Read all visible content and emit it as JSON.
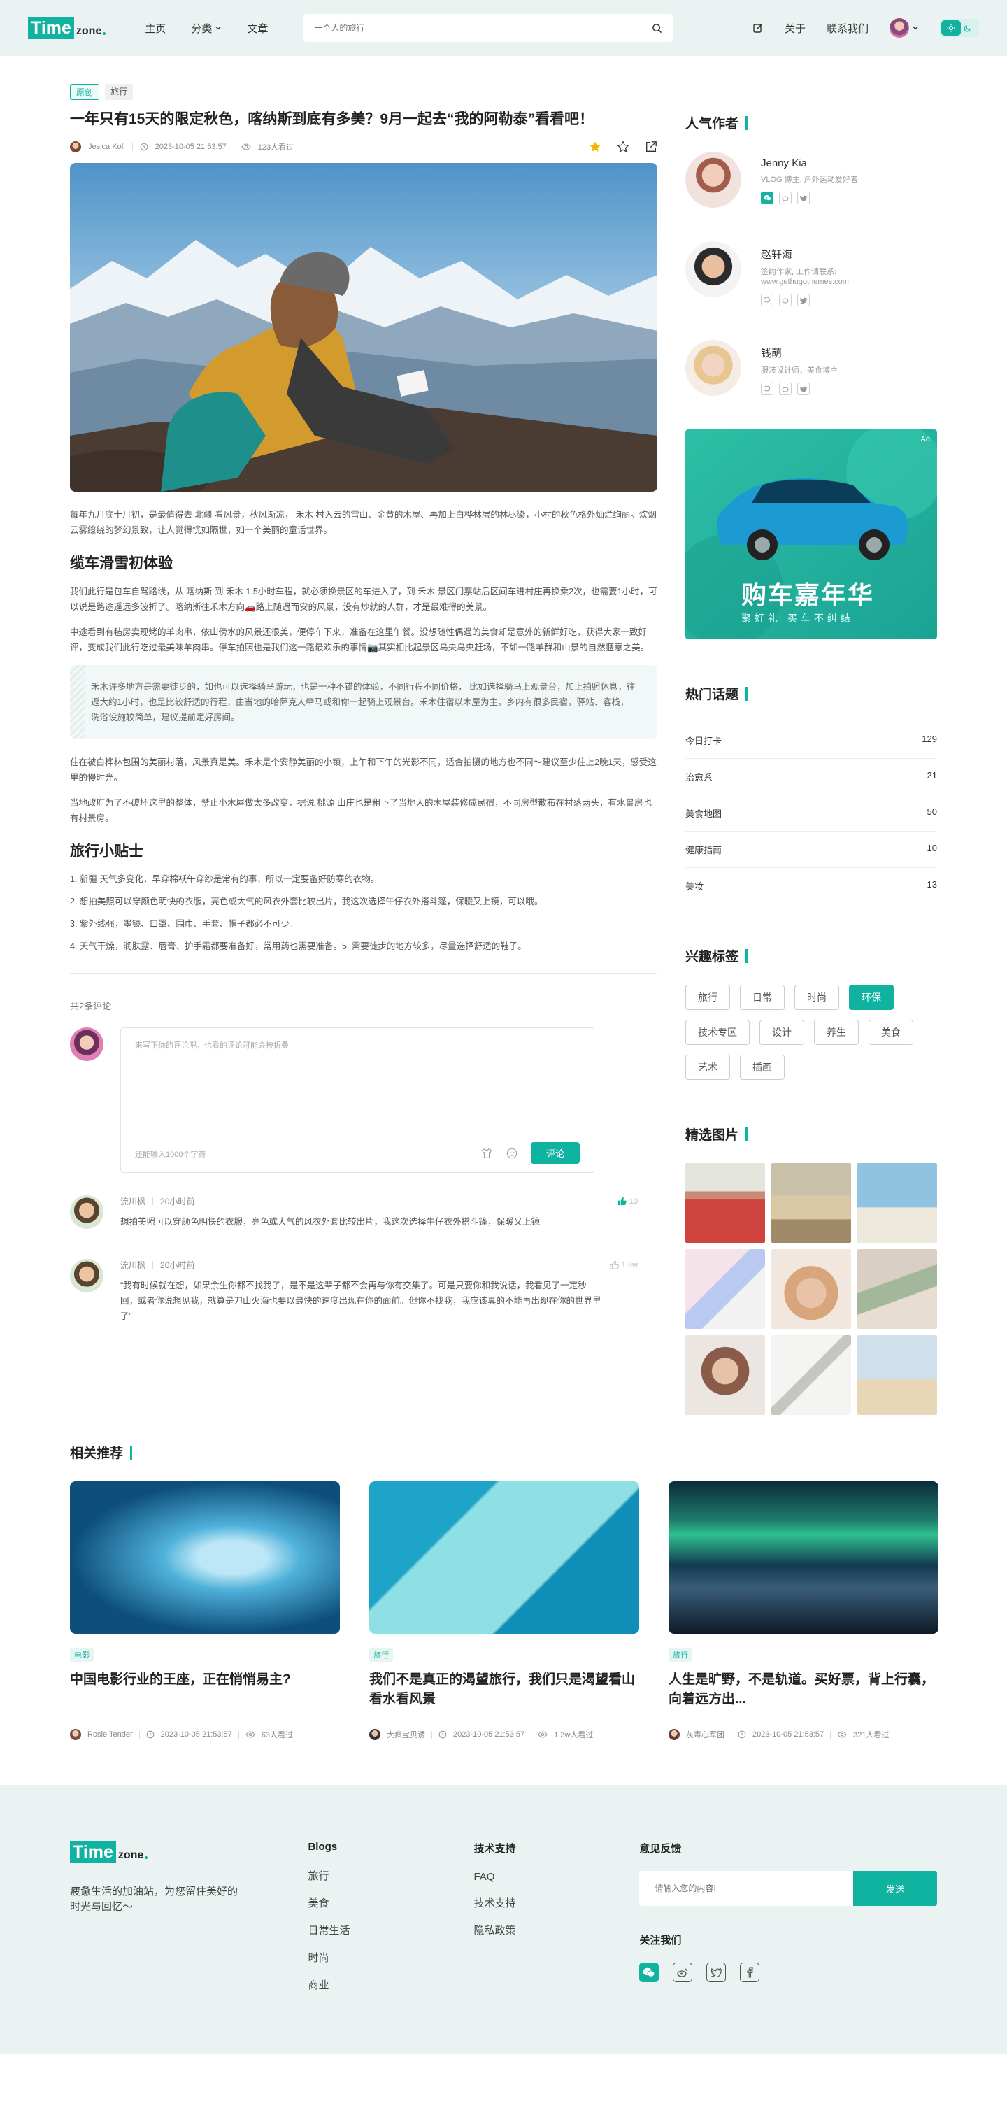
{
  "header": {
    "logo_box": "Time",
    "logo_rest": "zone",
    "nav": [
      "主页",
      "分类",
      "文章"
    ],
    "search_placeholder": "一个人的旅行",
    "links": [
      "关于",
      "联系我们"
    ]
  },
  "article": {
    "tags": [
      "原创",
      "旅行"
    ],
    "title": "一年只有15天的限定秋色，喀纳斯到底有多美？9月一起去“我的阿勒泰”看看吧！",
    "author": "Jesica Koli",
    "date": "2023-10-05 21:53:57",
    "views": "123人看过",
    "p1": "每年九月底十月初，是最值得去 北疆 看风景，秋风渐凉， 禾木 村入云的雪山、金黄的木屋、再加上白桦林层的林尽染，小村的秋色格外灿烂绚丽。炊烟云雾缭绕的梦幻景致，让人觉得恍如隔世，如一个美丽的童话世界。",
    "h2a": "缆车滑雪初体验",
    "p2": "我们此行是包车自驾路线，从 喀纳斯 到 禾木 1.5小时车程，就必须换景区的车进入了，到 禾木 景区门票站后区间车进村庄再换乘2次，也需要1小时，可以说是路途遥远多波折了。喀纳斯往禾木方向🚗路上随遇而安的风景，没有炒就的人群，才是最难得的美景。",
    "p3": "中途看到有毡房卖现烤的羊肉串，依山傍水的风景还很美，便停车下来，准备在这里午餐。没想随性偶遇的美食却是意外的新鲜好吃，获得大家一致好评，变成我们此行吃过最美味羊肉串。停车拍照也是我们这一路最欢乐的事情📷其实相比起景区乌央乌央赶场，不如一路羊群和山景的自然惬意之美。",
    "quote": "禾木许多地方是需要徒步的，如也可以选择骑马游玩，也是一种不错的体验，不同行程不同价格， 比如选择骑马上观景台，加上拍照休息，往返大约1小时，也是比较舒适的行程，由当地的哈萨克人牵马或和你一起骑上观景台。禾木住宿以木屋为主，乡内有很多民宿，驿站、客栈，洗浴设施较简单，建议提前定好房间。",
    "p4": "住在被白桦林包围的美丽村落，风景真是美。禾木是个安静美丽的小镇，上午和下午的光影不同，适合拍摄的地方也不同～建议至少住上2晚1天，感受这里的慢时光。",
    "p5": "当地政府为了不破坏这里的整体，禁止小木屋做太多改变，据说 桃源 山庄也是租下了当地人的木屋装修成民宿，不同房型散布在村落两头，有水景房也有村景房。",
    "h2b": "旅行小贴士",
    "tips": [
      "1. 新疆 天气多变化，早穿棉袄午穿纱是常有的事，所以一定要备好防寒的衣物。",
      "2. 想拍美照可以穿颜色明快的衣服，亮色或大气的风衣外套比较出片，我这次选择牛仔衣外搭斗篷，保暖又上镜，可以哦。",
      "3. 紫外线强，墨镜、口罩、围巾、手套、帽子都必不可少。",
      "4. 天气干燥，润肤露、唇膏、护手霜都要准备好，常用药也需要准备。5. 需要徒步的地方较多，尽量选择舒适的鞋子。"
    ]
  },
  "comments_section": {
    "count": "共2条评论",
    "placeholder": "来写下你的评论吧，也看的评论可能会被折叠",
    "limit": "还能输入1000个字符",
    "submit": "评论",
    "items": [
      {
        "name": "流川枫",
        "time": "20小时前",
        "likes": "10",
        "text": "想拍美照可以穿颜色明快的衣服，亮色或大气的风衣外套比较出片，我这次选择牛仔衣外搭斗篷，保暖又上镜"
      },
      {
        "name": "流川枫",
        "time": "20小时前",
        "likes": "1.3w",
        "text": "“我有时候就在想，如果余生你都不找我了，是不是这辈子都不会再与你有交集了。可是只要你和我说话，我看见了一定秒回，或者你说想见我，就算是刀山火海也要以最快的速度出现在你的面前。但你不找我，我应该真的不能再出现在你的世界里了”"
      }
    ]
  },
  "sidebar": {
    "authors_title": "人气作者",
    "authors": [
      {
        "name": "Jenny Kia",
        "desc": "VLOG 博主, 户外运动爱好者",
        "desc2": ""
      },
      {
        "name": "赵轩海",
        "desc": "签约作家, 工作请联系:",
        "desc2": "www.gethugothemes.com"
      },
      {
        "name": "钱萌",
        "desc": "服装设计师，美食博主",
        "desc2": ""
      }
    ],
    "ad_label": "Ad",
    "ad_title": "购车嘉年华",
    "ad_sub": "聚好礼 买车不纠结",
    "topics_title": "热门话题",
    "topics": [
      {
        "name": "今日打卡",
        "count": "129"
      },
      {
        "name": "治愈系",
        "count": "21"
      },
      {
        "name": "美食地图",
        "count": "50"
      },
      {
        "name": "健康指南",
        "count": "10"
      },
      {
        "name": "美妆",
        "count": "13"
      }
    ],
    "tags_title": "兴趣标签",
    "tags": [
      "旅行",
      "日常",
      "时尚",
      "环保",
      "技术专区",
      "设计",
      "养生",
      "美食",
      "艺术",
      "插画"
    ],
    "active_tag": "环保",
    "gallery_title": "精选图片"
  },
  "related": {
    "title": "相关推荐",
    "cards": [
      {
        "tag": "电影",
        "title": "中国电影行业的王座，正在悄悄易主?",
        "author": "Rosie Tender",
        "date": "2023-10-05 21:53:57",
        "views": "63人看过"
      },
      {
        "tag": "旅行",
        "title": "我们不是真正的渴望旅行，我们只是渴望看山看水看风景",
        "author": "大疯宝贝诱",
        "date": "2023-10-05 21:53:57",
        "views": "1.3w人看过"
      },
      {
        "tag": "旅行",
        "title": "人生是旷野，不是轨道。买好票，背上行囊，向着远方出...",
        "author": "灰毒心军团",
        "date": "2023-10-05 21:53:57",
        "views": "321人看过"
      }
    ]
  },
  "footer": {
    "desc": "疲惫生活的加油站，为您留住美好的时光与回忆～",
    "col1_title": "Blogs",
    "col1": [
      "旅行",
      "美食",
      "日常生活",
      "时尚",
      "商业"
    ],
    "col2_title": "技术支持",
    "col2": [
      "FAQ",
      "技术支持",
      "隐私政策"
    ],
    "fb_title": "意见反馈",
    "fb_placeholder": "请输入您的内容!",
    "fb_submit": "发送",
    "follow_title": "关注我们"
  },
  "colors": {
    "accent": "#0fb3a0",
    "header_bg": "#eaf3f2"
  }
}
